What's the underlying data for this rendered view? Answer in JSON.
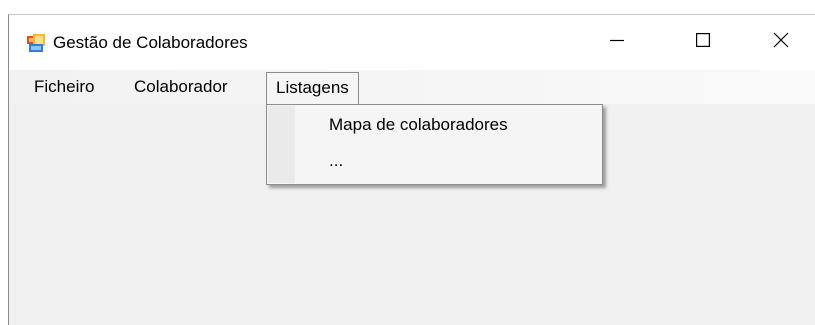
{
  "window": {
    "title": "Gestão de Colaboradores",
    "icon": "app-window-icon",
    "controls": {
      "minimize": "minimize-icon",
      "maximize": "maximize-icon",
      "close": "close-icon"
    }
  },
  "menubar": {
    "items": [
      {
        "label": "Ficheiro"
      },
      {
        "label": "Colaborador"
      },
      {
        "label": "Listagens",
        "open": true
      }
    ]
  },
  "dropdown": {
    "items": [
      {
        "label": "Mapa de colaboradores"
      },
      {
        "label": "..."
      }
    ]
  },
  "colors": {
    "client_area": "#f0f0f0",
    "titlebar": "#ffffff",
    "menu_border": "#8c8c8c"
  }
}
